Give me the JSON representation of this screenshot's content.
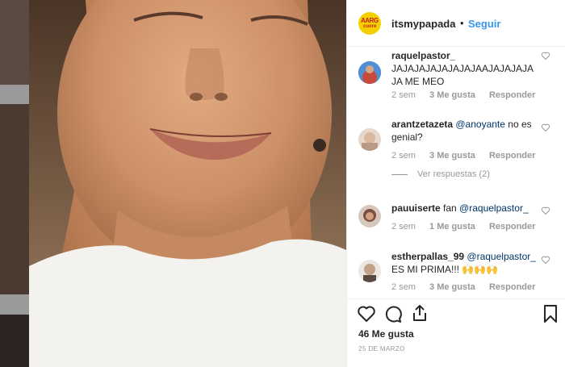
{
  "post": {
    "author": "itsmypapada",
    "separator": "•",
    "follow_label": "Seguir",
    "avatar_text_1": "AARG",
    "avatar_text_2": "cuore"
  },
  "comments": [
    {
      "username": "raquelpastor_",
      "text": "JAJAJAJAJAJAJAJAAJAJAJAJAJA ME MEO",
      "mention": "",
      "time": "2 sem",
      "likes": "3 Me gusta",
      "reply_label": "Responder",
      "avatar_color": "#c94a3a"
    },
    {
      "username": "arantzetazeta",
      "mention": "@anoyante",
      "text": " no es genial?",
      "time": "2 sem",
      "likes": "3 Me gusta",
      "reply_label": "Responder",
      "avatar_color": "#d9b8a0"
    },
    {
      "username": "pauuiserte",
      "text": "fan ",
      "mention": "@raquelpastor_",
      "time": "2 sem",
      "likes": "1 Me gusta",
      "reply_label": "Responder",
      "avatar_color": "#7a5040"
    },
    {
      "username": "estherpallas_99",
      "mention": "@raquelpastor_",
      "text": "ES MI PRIMA!!! 🙌🙌🙌",
      "time": "2 sem",
      "likes": "3 Me gusta",
      "reply_label": "Responder",
      "avatar_color": "#c4a088"
    }
  ],
  "view_replies_label": "Ver respuestas (2)",
  "footer": {
    "likes": "46 Me gusta",
    "date": "25 DE MARZO"
  },
  "icons": {
    "like": "heart-icon",
    "comment": "comment-icon",
    "share": "share-icon",
    "save": "bookmark-icon"
  }
}
